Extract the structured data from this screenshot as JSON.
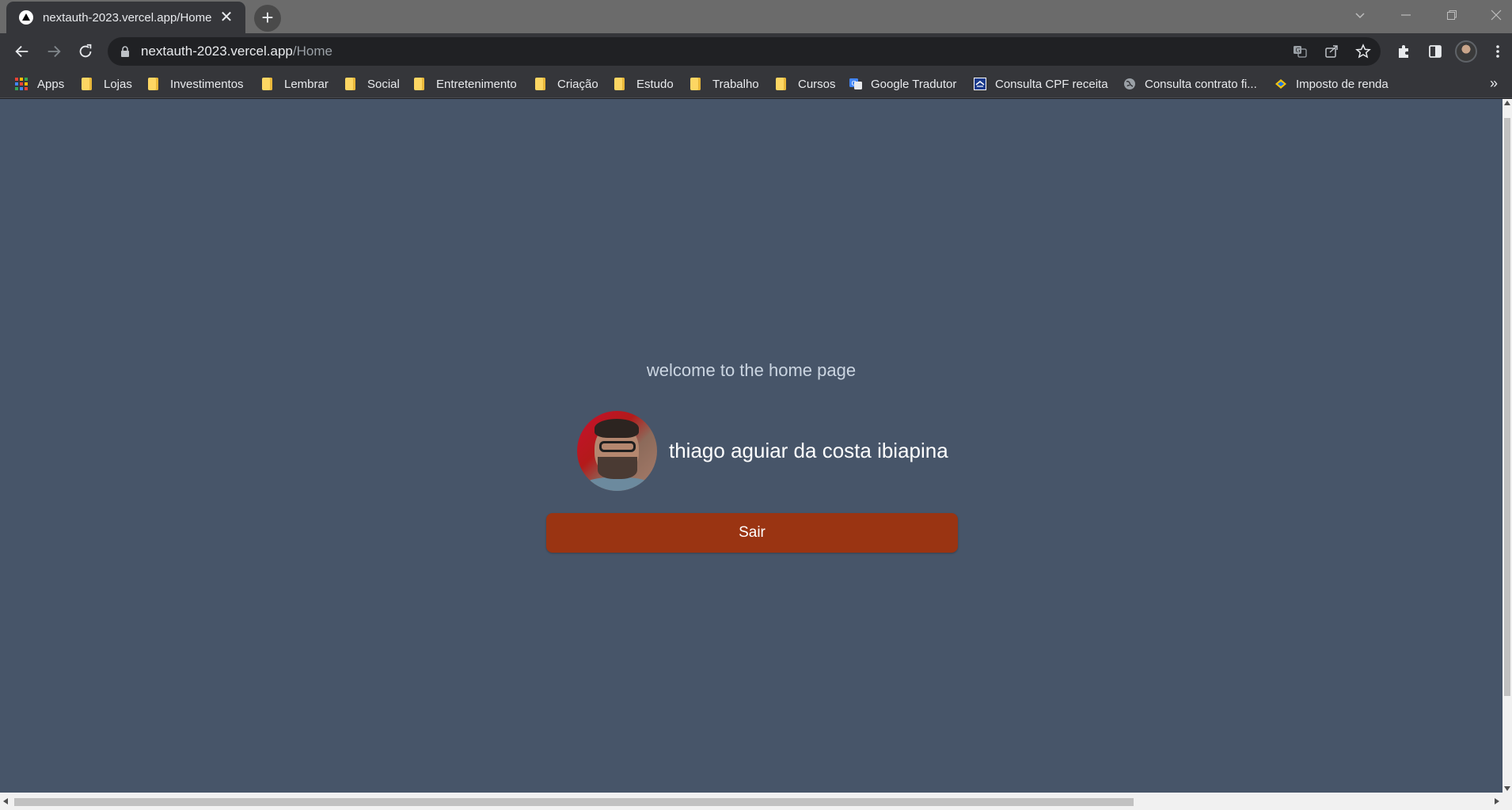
{
  "browser": {
    "tab_title": "nextauth-2023.vercel.app/Home",
    "url_host": "nextauth-2023.vercel.app",
    "url_path": "/Home"
  },
  "bookmarks": [
    {
      "label": "Apps",
      "icon": "apps-grid-icon"
    },
    {
      "label": "Lojas",
      "icon": "folder-icon"
    },
    {
      "label": "Investimentos",
      "icon": "folder-icon"
    },
    {
      "label": "Lembrar",
      "icon": "folder-icon"
    },
    {
      "label": "Social",
      "icon": "folder-icon"
    },
    {
      "label": "Entretenimento",
      "icon": "folder-icon"
    },
    {
      "label": "Criação",
      "icon": "folder-icon"
    },
    {
      "label": "Estudo",
      "icon": "folder-icon"
    },
    {
      "label": "Trabalho",
      "icon": "folder-icon"
    },
    {
      "label": "Cursos",
      "icon": "folder-icon"
    },
    {
      "label": "Google Tradutor",
      "icon": "google-translate-icon"
    },
    {
      "label": "Consulta CPF receita",
      "icon": "receita-icon"
    },
    {
      "label": "Consulta contrato fi...",
      "icon": "globe-icon"
    },
    {
      "label": "Imposto de renda",
      "icon": "imposto-icon"
    }
  ],
  "page": {
    "welcome": "welcome to the home page",
    "user_name": "thiago aguiar da costa ibiapina",
    "signout_label": "Sair"
  },
  "colors": {
    "page_background": "#475569",
    "signout_button": "#9a3412",
    "welcome_text": "#cbd5e1"
  }
}
